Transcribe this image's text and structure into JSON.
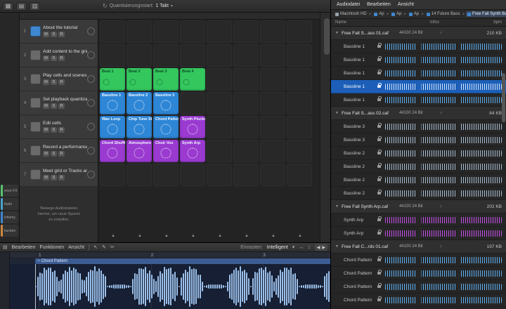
{
  "palette": {
    "green": "#34c75e",
    "blue": "#2e86d6",
    "purple": "#9a3ad0",
    "selection": "#1d5fb8"
  },
  "icons": {
    "grid": "▦",
    "panel": "▤",
    "mixer": "▥",
    "refresh": "↻",
    "chevron": "▾",
    "wave": "≈",
    "tri_down": "▼",
    "tempo": "♪",
    "crumb_sep": "▸",
    "scene": "▲",
    "pointer": "↖",
    "pencil": "✎",
    "scissors": "✂",
    "hzoom": "↔",
    "vzoom": "↕",
    "left": "◀",
    "right": "▶"
  },
  "top_toolbar": {
    "quantize_label": "Quantisierungsstart:",
    "quantize_value": "1 Takt"
  },
  "left_rail": {
    "chips": [
      {
        "label": "ence FX",
        "color": "#58c472"
      },
      {
        "label": "ttude",
        "color": "#4aa3c9"
      },
      {
        "label": "lchemy",
        "color": "#3f87d0"
      },
      {
        "label": "kuchen",
        "color": "#d0883f"
      }
    ]
  },
  "track_area": {
    "msr": [
      "M",
      "S",
      "R"
    ],
    "tracks": [
      {
        "num": "1",
        "name": "About the tutorial",
        "icon_color": "#3f87d0"
      },
      {
        "num": "2",
        "name": "Add content to the grid",
        "icon_color": "#6a6a6a"
      },
      {
        "num": "3",
        "name": "Play cells and scenes",
        "icon_color": "#6a6a6a"
      },
      {
        "num": "4",
        "name": "Set playback quantization",
        "icon_color": "#6a6a6a"
      },
      {
        "num": "5",
        "name": "Edit cells",
        "icon_color": "#6a6a6a"
      },
      {
        "num": "6",
        "name": "Record a performance",
        "icon_color": "#6a6a6a"
      },
      {
        "num": "7",
        "name": "Meet grid or Tracks area content",
        "icon_color": "#6a6a6a"
      }
    ],
    "drop_hint_lines": [
      "Bewege Audiodateien",
      "hierher, um neue Spuren",
      "zu erstellen."
    ]
  },
  "grid": {
    "scene_count": 8,
    "rows": [
      {
        "track": 3,
        "cells": [
          {
            "label": "Beat 1",
            "color": "green"
          },
          {
            "label": "Beat 2",
            "color": "green"
          },
          {
            "label": "Beat 3",
            "color": "green"
          },
          {
            "label": "Beat 4",
            "color": "green"
          }
        ]
      },
      {
        "track": 4,
        "cells": [
          {
            "label": "Bassline 1",
            "color": "blue"
          },
          {
            "label": "Bassline 2",
            "color": "blue"
          },
          {
            "label": "Bassline 3",
            "color": "blue"
          }
        ]
      },
      {
        "track": 5,
        "cells": [
          {
            "label": "Wav Loop",
            "color": "blue"
          },
          {
            "label": "Chip Tune Skit",
            "color": "blue"
          },
          {
            "label": "Chord Pattern",
            "color": "blue"
          },
          {
            "label": "Synth Plucks",
            "color": "purple"
          }
        ]
      },
      {
        "track": 6,
        "cells": [
          {
            "label": "Chord Shuffle",
            "color": "purple"
          },
          {
            "label": "Atmosphere",
            "color": "purple"
          },
          {
            "label": "Choir Vox",
            "color": "purple"
          },
          {
            "label": "Synth Arp",
            "color": "purple"
          }
        ]
      }
    ]
  },
  "editor": {
    "menus": [
      "Bearbeiten",
      "Funktionen",
      "Ansicht"
    ],
    "snap_label": "Einrasten:",
    "snap_value": "Intelligent",
    "region_name": "Chord Pattern",
    "ruler_ticks": [
      {
        "label": "1",
        "pos": 9
      },
      {
        "label": "2",
        "pos": 44
      },
      {
        "label": "3",
        "pos": 79
      }
    ]
  },
  "browser": {
    "menus": [
      "Audiodatei",
      "Bearbeiten",
      "Ansicht"
    ],
    "breadcrumb": [
      "Macintosh HD",
      "Ap",
      "Ap",
      "Ap",
      "14 Future Bass",
      "Free Fall Synth Bass"
    ],
    "columns": [
      "Name",
      "Infos",
      "bpm"
    ],
    "groups": [
      {
        "file": "Free Fall S...ass 01.caf",
        "info": "44100 24 Bit",
        "size": "210 KB",
        "wave_color": "#5fb0f2",
        "items": [
          {
            "name": "Bassline 1"
          },
          {
            "name": "Bassline 1"
          },
          {
            "name": "Bassline 1"
          },
          {
            "name": "Bassline 1",
            "selected": true
          },
          {
            "name": "Bassline 1"
          }
        ]
      },
      {
        "file": "Free Fall S...ass 02.caf",
        "info": "44100 24 Bit",
        "size": "84 KB",
        "wave_color": "#a9bdd1",
        "items": [
          {
            "name": "Bassline 3"
          },
          {
            "name": "Bassline 3"
          },
          {
            "name": "Bassline 2"
          },
          {
            "name": "Bassline 2"
          },
          {
            "name": "Bassline 2"
          },
          {
            "name": "Bassline 2"
          }
        ]
      },
      {
        "file": "Free Fall Synth Arp.caf",
        "info": "44100 24 Bit",
        "size": "202 KB",
        "wave_color": "#c44fe8",
        "items": [
          {
            "name": "Synth Arp"
          },
          {
            "name": "Synth Arp"
          }
        ]
      },
      {
        "file": "Free Fall C...rds 01.caf",
        "info": "44100 24 Bit",
        "size": "197 KB",
        "wave_color": "#5fb0f2",
        "items": [
          {
            "name": "Chord Pattern"
          },
          {
            "name": "Chord Pattern"
          },
          {
            "name": "Chord Pattern"
          },
          {
            "name": "Chord Pattern"
          }
        ]
      }
    ]
  }
}
